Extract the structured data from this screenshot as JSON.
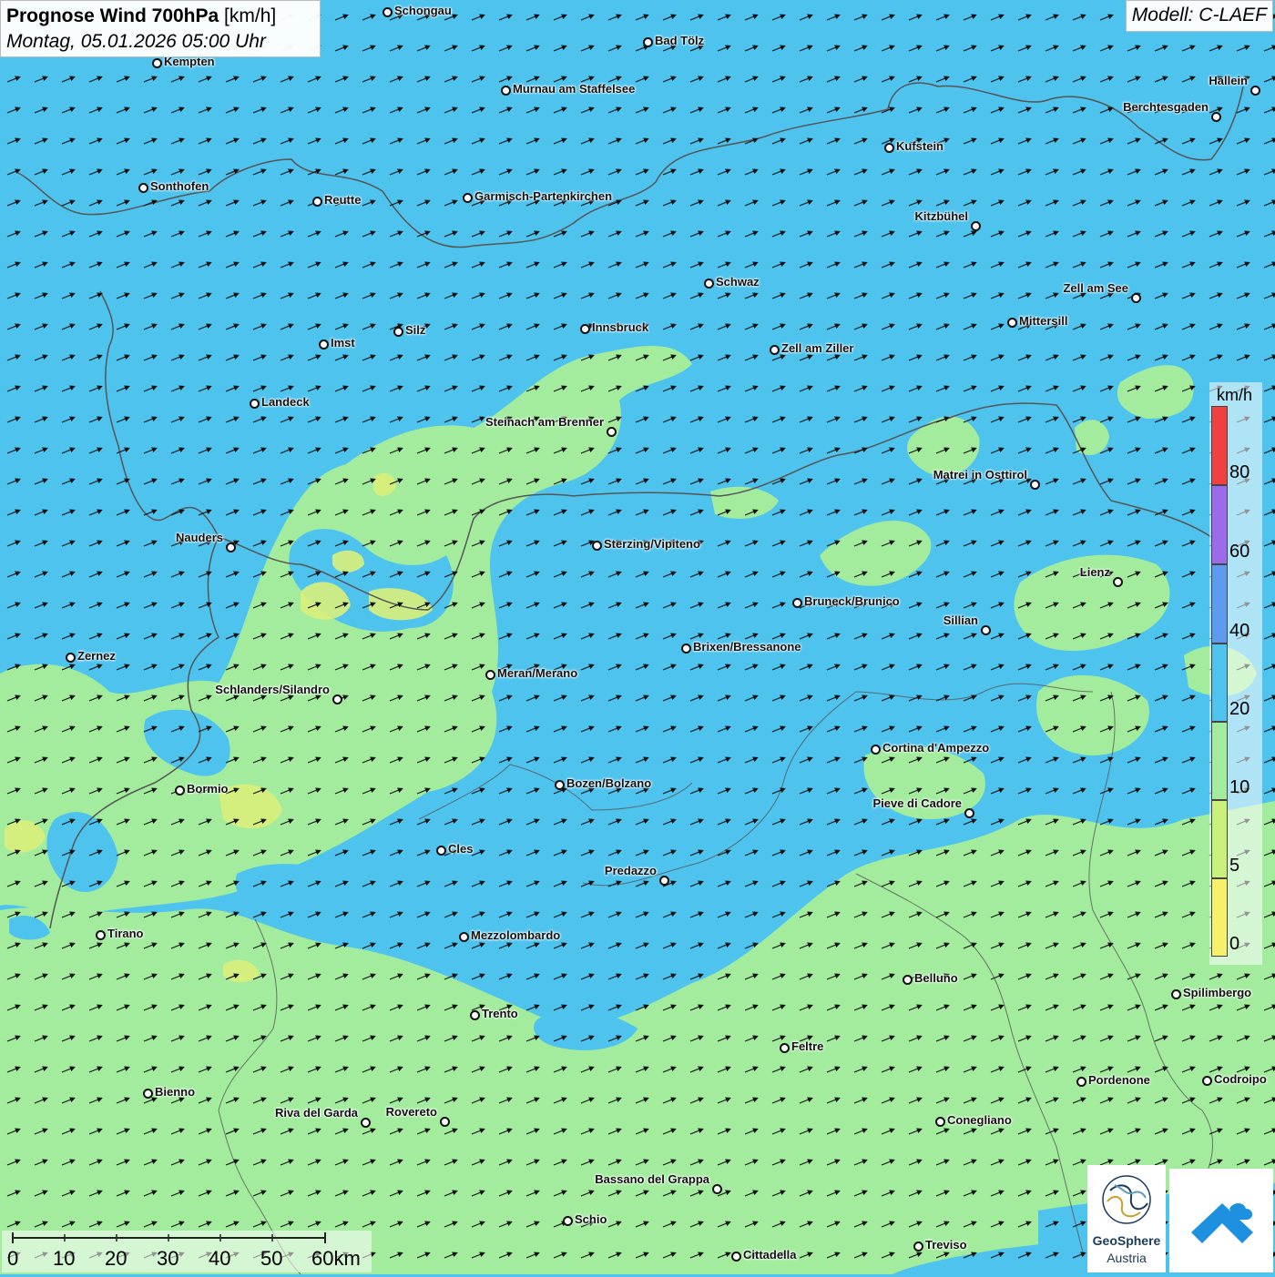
{
  "header": {
    "title_bold": "Prognose Wind 700hPa",
    "title_unit": "[km/h]",
    "subtitle": "Montag, 05.01.2026 05:00 Uhr",
    "model": "Modell: C-LAEF"
  },
  "colors": {
    "wind_0_5": "#f7f06a",
    "wind_5_10": "#c8f07a",
    "wind_10_20": "#a3ec9e",
    "wind_20_40": "#4ec3ee",
    "wind_40_60": "#5c9bef",
    "wind_60_80": "#9b6bea",
    "wind_80_plus": "#f04040",
    "border": "#555555"
  },
  "legend": {
    "unit": "km/h",
    "ticks": [
      "80",
      "60",
      "40",
      "20",
      "10",
      "5",
      "0"
    ]
  },
  "scale_bar": {
    "labels": [
      "0",
      "10",
      "20",
      "30",
      "40",
      "50",
      "60km"
    ]
  },
  "wind_arrow_icon": "arrow-northeast-icon",
  "cities": [
    {
      "name": "Schongau",
      "label": "Schongau"
    },
    {
      "name": "Bad Tölz",
      "label": "Bad Tölz"
    },
    {
      "name": "Kempten",
      "label": "Kempten"
    },
    {
      "name": "Murnau am Staffelsee",
      "label": "Murnau am Staffelsee"
    },
    {
      "name": "Hallein",
      "label": "Hallein"
    },
    {
      "name": "Berchtesgaden",
      "label": "Berchtesgaden"
    },
    {
      "name": "Kufstein",
      "label": "Kufstein"
    },
    {
      "name": "Sonthofen",
      "label": "Sonthofen"
    },
    {
      "name": "Reutte",
      "label": "Reutte"
    },
    {
      "name": "Garmisch-Partenkirchen",
      "label": "Garmisch-Partenkirchen"
    },
    {
      "name": "Kitzbühel",
      "label": "Kitzbühel"
    },
    {
      "name": "Schwaz",
      "label": "Schwaz"
    },
    {
      "name": "Zell am See",
      "label": "Zell am See"
    },
    {
      "name": "Mittersill",
      "label": "Mittersill"
    },
    {
      "name": "Innsbruck",
      "label": "Innsbruck"
    },
    {
      "name": "Silz",
      "label": "Silz"
    },
    {
      "name": "Imst",
      "label": "Imst"
    },
    {
      "name": "Zell am Ziller",
      "label": "Zell am Ziller"
    },
    {
      "name": "Landeck",
      "label": "Landeck"
    },
    {
      "name": "Steinach am Brenner",
      "label": "Steinach am Brenner"
    },
    {
      "name": "Matrei in Osttirol",
      "label": "Matrei in Osttirol"
    },
    {
      "name": "Nauders",
      "label": "Nauders"
    },
    {
      "name": "Sterzing/Vipiteno",
      "label": "Sterzing/Vipiteno"
    },
    {
      "name": "Lienz",
      "label": "Lienz"
    },
    {
      "name": "Bruneck/Brunico",
      "label": "Bruneck/Brunico"
    },
    {
      "name": "Sillian",
      "label": "Sillian"
    },
    {
      "name": "Brixen/Bressanone",
      "label": "Brixen/Bressanone"
    },
    {
      "name": "Zernez",
      "label": "Zernez"
    },
    {
      "name": "Meran/Merano",
      "label": "Meran/Merano"
    },
    {
      "name": "Schlanders/Silandro",
      "label": "Schlanders/Silandro"
    },
    {
      "name": "Cortina d'Ampezzo",
      "label": "Cortina d'Ampezzo"
    },
    {
      "name": "Bozen/Bolzano",
      "label": "Bozen/Bolzano"
    },
    {
      "name": "Bormio",
      "label": "Bormio"
    },
    {
      "name": "Pieve di Cadore",
      "label": "Pieve di Cadore"
    },
    {
      "name": "Cles",
      "label": "Cles"
    },
    {
      "name": "Predazzo",
      "label": "Predazzo"
    },
    {
      "name": "Tirano",
      "label": "Tirano"
    },
    {
      "name": "Mezzolombardo",
      "label": "Mezzolombardo"
    },
    {
      "name": "Belluno",
      "label": "Belluno"
    },
    {
      "name": "Spilimbergo",
      "label": "Spilimbergo"
    },
    {
      "name": "Trento",
      "label": "Trento"
    },
    {
      "name": "Feltre",
      "label": "Feltre"
    },
    {
      "name": "Pordenone",
      "label": "Pordenone"
    },
    {
      "name": "Codroipo",
      "label": "Codroipo"
    },
    {
      "name": "Bienno",
      "label": "Bienno"
    },
    {
      "name": "Riva del Garda",
      "label": "Riva del Garda"
    },
    {
      "name": "Rovereto",
      "label": "Rovereto"
    },
    {
      "name": "Conegliano",
      "label": "Conegliano"
    },
    {
      "name": "Bassano del Grappa",
      "label": "Bassano del Grappa"
    },
    {
      "name": "Schio",
      "label": "Schio"
    },
    {
      "name": "Treviso",
      "label": "Treviso"
    },
    {
      "name": "Cittadella",
      "label": "Cittadella"
    }
  ],
  "logos": {
    "geosphere_line1": "GeoSphere",
    "geosphere_line2": "Austria"
  }
}
